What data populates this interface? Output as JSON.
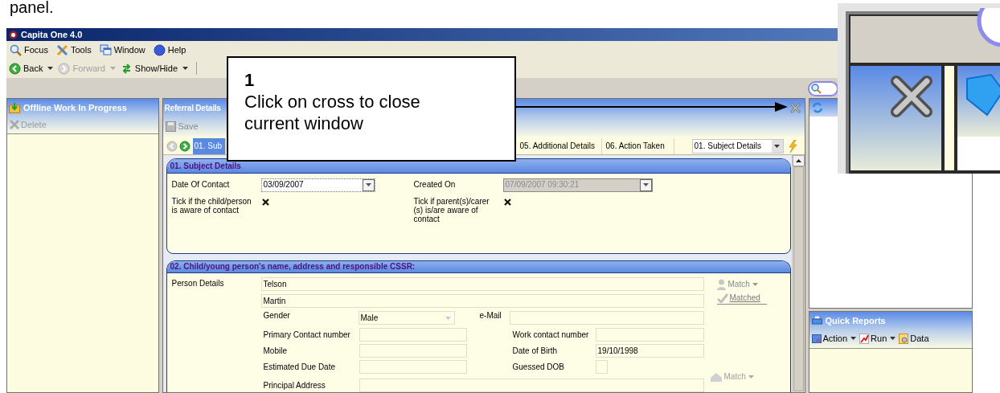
{
  "document_text": "panel.",
  "app": {
    "title": "Capita One 4.0",
    "menu": [
      {
        "label": "Focus"
      },
      {
        "label": "Tools"
      },
      {
        "label": "Window"
      },
      {
        "label": "Help"
      }
    ],
    "toolbar": [
      {
        "label": "Back",
        "disabled": false
      },
      {
        "label": "Forward",
        "disabled": true
      },
      {
        "label": "Show/Hide",
        "disabled": false
      }
    ],
    "left_panel": {
      "title": "Offline Work In Progress",
      "actions": [
        {
          "label": "Delete",
          "disabled": true
        }
      ]
    },
    "referral": {
      "title": "Referral Details",
      "toolbar": [
        {
          "label": "Save",
          "disabled": true
        }
      ],
      "tabs": [
        {
          "label": "01. Sub",
          "selected": true
        },
        {
          "label": "05. Additional Details",
          "selected": false
        },
        {
          "label": "06. Action Taken",
          "selected": false
        }
      ],
      "section_select": "01. Subject Details",
      "subject": {
        "title": "01. Subject Details",
        "date_of_contact": {
          "label": "Date Of Contact",
          "value": "03/09/2007"
        },
        "created_on": {
          "label": "Created On",
          "value": "07/09/2007 09:30:21",
          "disabled": true
        },
        "child_aware": {
          "label": "Tick if the child/person is aware of contact",
          "checked": true
        },
        "parent_aware": {
          "label": "Tick if parent(s)/carer (s) is/are aware of contact",
          "checked": true
        }
      },
      "person": {
        "title": "02. Child/young person's name, address and responsible CSSR:",
        "label": "Person Details",
        "surname": "Telson",
        "forename": "Martin",
        "gender": {
          "label": "Gender",
          "value": "Male"
        },
        "email": {
          "label": "e-Mail"
        },
        "fields": [
          {
            "label": "Primary Contact number",
            "kind": "text"
          },
          {
            "label": "Work contact number",
            "kind": "text"
          },
          {
            "label": "Mobile",
            "kind": "text"
          },
          {
            "label": "Date of Birth",
            "kind": "text",
            "value": "19/10/1998"
          },
          {
            "label": "Estimated Due Date",
            "kind": "text"
          },
          {
            "label": "Guessed DOB",
            "kind": "checkbox",
            "checked": false
          }
        ],
        "address": {
          "label": "Principal Address",
          "match": "Match"
        },
        "match_actions": [
          {
            "label": "Match",
            "kind": "menu"
          },
          {
            "label": "Matched",
            "kind": "link"
          }
        ]
      }
    },
    "quick_reports": {
      "title": "Quick Reports",
      "actions": [
        {
          "label": "Action",
          "dropdown": true
        },
        {
          "label": "Run",
          "dropdown": true
        },
        {
          "label": "Data",
          "dropdown": false
        }
      ]
    }
  },
  "callout": {
    "number": "1",
    "text": "Click on cross to close current window"
  }
}
